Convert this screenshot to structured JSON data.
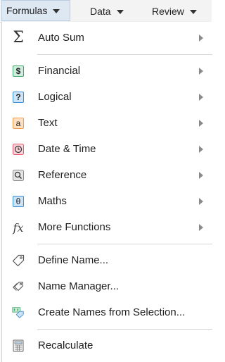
{
  "tabs": [
    {
      "label": "Formulas",
      "active": true
    },
    {
      "label": "Data",
      "active": false
    },
    {
      "label": "Review",
      "active": false
    }
  ],
  "menu": {
    "items": [
      {
        "label": "Auto Sum",
        "icon": "sigma-icon",
        "submenu": true
      },
      {
        "label": "Financial",
        "icon": "dollar-icon",
        "submenu": true,
        "color": "#3fa66b"
      },
      {
        "label": "Logical",
        "icon": "question-icon",
        "submenu": true,
        "color": "#3b8fd6"
      },
      {
        "label": "Text",
        "icon": "text-a-icon",
        "submenu": true,
        "color": "#f29d4b"
      },
      {
        "label": "Date & Time",
        "icon": "clock-icon",
        "submenu": true,
        "color": "#e55b6a"
      },
      {
        "label": "Reference",
        "icon": "magnifier-icon",
        "submenu": true,
        "color": "#8a8a8a"
      },
      {
        "label": "Maths",
        "icon": "theta-icon",
        "submenu": true,
        "color": "#3b8fd6"
      },
      {
        "label": "More Functions",
        "icon": "fx-icon",
        "submenu": true
      },
      {
        "label": "Define Name...",
        "icon": "tag-icon",
        "submenu": false
      },
      {
        "label": "Name Manager...",
        "icon": "tags-icon",
        "submenu": false
      },
      {
        "label": "Create Names from Selection...",
        "icon": "create-names-icon",
        "submenu": false
      },
      {
        "label": "Recalculate",
        "icon": "calculator-icon",
        "submenu": false
      }
    ]
  },
  "icon_glyphs": {
    "dollar": "$",
    "question": "?",
    "text_a": "a",
    "theta": "θ",
    "sigma": "Σ",
    "fx": "fx"
  }
}
